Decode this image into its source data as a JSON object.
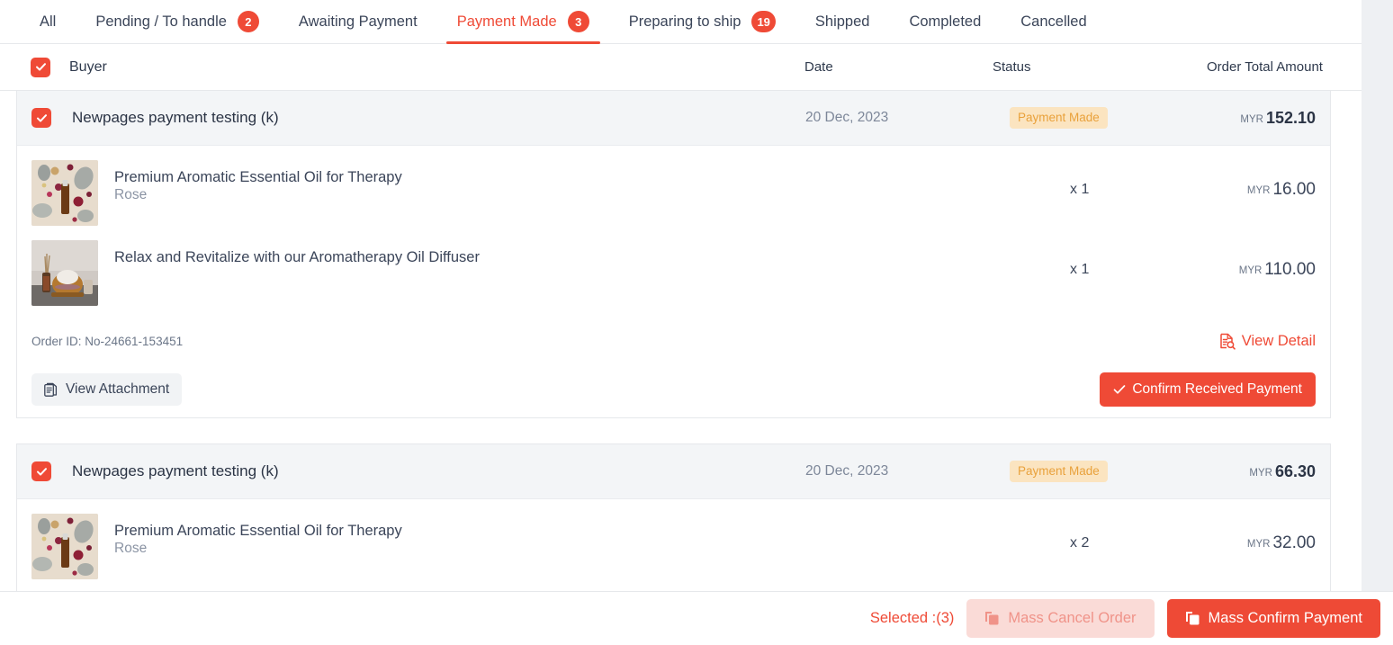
{
  "tabs": [
    {
      "label": "All",
      "badge": null,
      "active": false
    },
    {
      "label": "Pending / To handle",
      "badge": "2",
      "active": false
    },
    {
      "label": "Awaiting Payment",
      "badge": null,
      "active": false
    },
    {
      "label": "Payment Made",
      "badge": "3",
      "active": true
    },
    {
      "label": "Preparing to ship",
      "badge": "19",
      "active": false
    },
    {
      "label": "Shipped",
      "badge": null,
      "active": false
    },
    {
      "label": "Completed",
      "badge": null,
      "active": false
    },
    {
      "label": "Cancelled",
      "badge": null,
      "active": false
    }
  ],
  "columns": {
    "buyer": "Buyer",
    "date": "Date",
    "status": "Status",
    "total": "Order Total Amount"
  },
  "orders": [
    {
      "buyer": "Newpages payment testing (k)",
      "date": "20 Dec, 2023",
      "status": "Payment Made",
      "currency": "MYR",
      "total": "152.10",
      "order_id": "Order ID: No-24661-153451",
      "view_detail": "View Detail",
      "view_attachment": "View Attachment",
      "confirm_label": "Confirm Received Payment",
      "items": [
        {
          "name": "Premium Aromatic Essential Oil for Therapy",
          "variant": "Rose",
          "qty": "x  1",
          "currency": "MYR",
          "price": "16.00",
          "image": "essential-oil-flatlay"
        },
        {
          "name": "Relax and Revitalize with our Aromatherapy Oil Diffuser",
          "variant": "",
          "qty": "x  1",
          "currency": "MYR",
          "price": "110.00",
          "image": "oil-diffuser-photo"
        }
      ]
    },
    {
      "buyer": "Newpages payment testing (k)",
      "date": "20 Dec, 2023",
      "status": "Payment Made",
      "currency": "MYR",
      "total": "66.30",
      "items": [
        {
          "name": "Premium Aromatic Essential Oil for Therapy",
          "variant": "Rose",
          "qty": "x  2",
          "currency": "MYR",
          "price": "32.00",
          "image": "essential-oil-flatlay"
        }
      ]
    }
  ],
  "bottom_bar": {
    "selected_label": "Selected :(3)",
    "mass_cancel": "Mass Cancel Order",
    "mass_confirm": "Mass Confirm Payment"
  },
  "colors": {
    "accent": "#ef4a36",
    "status_badge_bg": "#fbe4c0",
    "status_badge_text": "#e9a13b",
    "row_header_bg": "#f3f5f7"
  }
}
